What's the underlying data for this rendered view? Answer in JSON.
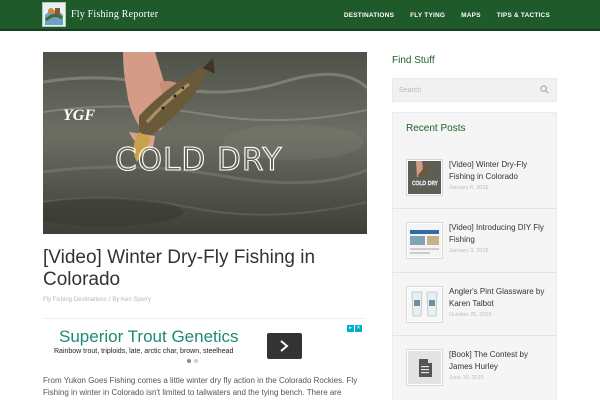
{
  "header": {
    "site_title": "Fly Fishing Reporter",
    "nav": [
      "DESTINATIONS",
      "FLY TYING",
      "MAPS",
      "TIPS & TACTICS"
    ],
    "bar_color": "#1e5a2a"
  },
  "hero": {
    "logo_text": "YGF",
    "overlay_text": "COLD DRY"
  },
  "post": {
    "title": "[Video] Winter Dry-Fly Fishing in Colorado",
    "category": "Fly Fishing Destinations",
    "separator": "/",
    "author": "By Ken Sperry",
    "excerpt": "From Yukon Goes Fishing comes a little winter dry fly action in the Colorado Rockies. Fly Fishing in winter in Colorado isn't limited to tailwaters and the tying bench. There are spring"
  },
  "ad": {
    "headline": "Superior Trout Genetics",
    "subtext": "Rainbow trout, triploids, late, arctic char, brown, steelhead",
    "accent": "#1d8a74"
  },
  "sidebar": {
    "find_heading": "Find Stuff",
    "search_placeholder": "Search",
    "recent_heading": "Recent Posts",
    "posts": [
      {
        "title": "[Video] Winter Dry-Fly Fishing in Colorado",
        "date": "January 6, 2016",
        "thumb_label": "COLD DRY"
      },
      {
        "title": "[Video] Introducing DIY Fly Fishing",
        "date": "January 3, 2016"
      },
      {
        "title": "Angler's Pint Glassware by Karen Talbot",
        "date": "October 25, 2015"
      },
      {
        "title": "[Book] The Contest by James Hurley",
        "date": "June 10, 2015"
      }
    ]
  }
}
